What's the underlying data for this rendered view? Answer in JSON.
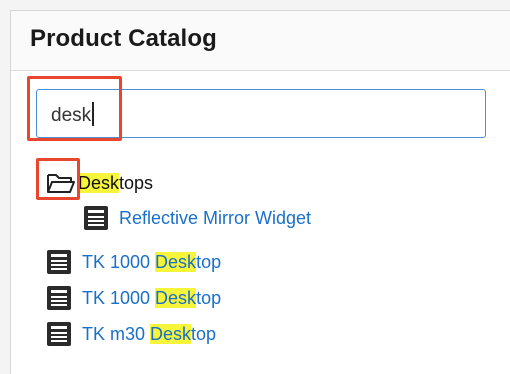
{
  "panel": {
    "title": "Product Catalog"
  },
  "search": {
    "value": "desk"
  },
  "tree": {
    "folder": {
      "label_match": "Desk",
      "label_rest": "tops",
      "icon": "folder-open-icon"
    },
    "folder_children": [
      {
        "label": "Reflective Mirror Widget",
        "icon": "product-list-icon"
      }
    ],
    "products": [
      {
        "label_prefix": "TK 1000 ",
        "label_match": "Desk",
        "label_rest": "top",
        "icon": "product-list-icon"
      },
      {
        "label_prefix": "TK 1000 ",
        "label_match": "Desk",
        "label_rest": "top",
        "icon": "product-list-icon"
      },
      {
        "label_prefix": "TK m30 ",
        "label_match": "Desk",
        "label_rest": "top",
        "icon": "product-list-icon"
      }
    ]
  },
  "colors": {
    "link": "#1a6fc9",
    "match_highlight": "#f7f53a",
    "annotation_box": "#e8462e",
    "input_focus_border": "#4a90d9"
  }
}
